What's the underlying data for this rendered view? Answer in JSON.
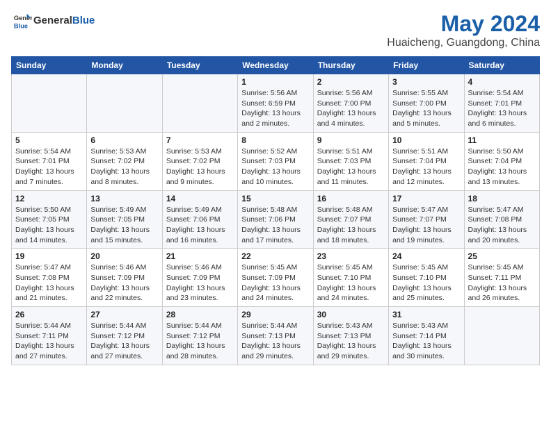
{
  "header": {
    "logo_general": "General",
    "logo_blue": "Blue",
    "title": "May 2024",
    "subtitle": "Huaicheng, Guangdong, China"
  },
  "days_of_week": [
    "Sunday",
    "Monday",
    "Tuesday",
    "Wednesday",
    "Thursday",
    "Friday",
    "Saturday"
  ],
  "weeks": [
    [
      {
        "day": "",
        "info": ""
      },
      {
        "day": "",
        "info": ""
      },
      {
        "day": "",
        "info": ""
      },
      {
        "day": "1",
        "info": "Sunrise: 5:56 AM\nSunset: 6:59 PM\nDaylight: 13 hours\nand 2 minutes."
      },
      {
        "day": "2",
        "info": "Sunrise: 5:56 AM\nSunset: 7:00 PM\nDaylight: 13 hours\nand 4 minutes."
      },
      {
        "day": "3",
        "info": "Sunrise: 5:55 AM\nSunset: 7:00 PM\nDaylight: 13 hours\nand 5 minutes."
      },
      {
        "day": "4",
        "info": "Sunrise: 5:54 AM\nSunset: 7:01 PM\nDaylight: 13 hours\nand 6 minutes."
      }
    ],
    [
      {
        "day": "5",
        "info": "Sunrise: 5:54 AM\nSunset: 7:01 PM\nDaylight: 13 hours\nand 7 minutes."
      },
      {
        "day": "6",
        "info": "Sunrise: 5:53 AM\nSunset: 7:02 PM\nDaylight: 13 hours\nand 8 minutes."
      },
      {
        "day": "7",
        "info": "Sunrise: 5:53 AM\nSunset: 7:02 PM\nDaylight: 13 hours\nand 9 minutes."
      },
      {
        "day": "8",
        "info": "Sunrise: 5:52 AM\nSunset: 7:03 PM\nDaylight: 13 hours\nand 10 minutes."
      },
      {
        "day": "9",
        "info": "Sunrise: 5:51 AM\nSunset: 7:03 PM\nDaylight: 13 hours\nand 11 minutes."
      },
      {
        "day": "10",
        "info": "Sunrise: 5:51 AM\nSunset: 7:04 PM\nDaylight: 13 hours\nand 12 minutes."
      },
      {
        "day": "11",
        "info": "Sunrise: 5:50 AM\nSunset: 7:04 PM\nDaylight: 13 hours\nand 13 minutes."
      }
    ],
    [
      {
        "day": "12",
        "info": "Sunrise: 5:50 AM\nSunset: 7:05 PM\nDaylight: 13 hours\nand 14 minutes."
      },
      {
        "day": "13",
        "info": "Sunrise: 5:49 AM\nSunset: 7:05 PM\nDaylight: 13 hours\nand 15 minutes."
      },
      {
        "day": "14",
        "info": "Sunrise: 5:49 AM\nSunset: 7:06 PM\nDaylight: 13 hours\nand 16 minutes."
      },
      {
        "day": "15",
        "info": "Sunrise: 5:48 AM\nSunset: 7:06 PM\nDaylight: 13 hours\nand 17 minutes."
      },
      {
        "day": "16",
        "info": "Sunrise: 5:48 AM\nSunset: 7:07 PM\nDaylight: 13 hours\nand 18 minutes."
      },
      {
        "day": "17",
        "info": "Sunrise: 5:47 AM\nSunset: 7:07 PM\nDaylight: 13 hours\nand 19 minutes."
      },
      {
        "day": "18",
        "info": "Sunrise: 5:47 AM\nSunset: 7:08 PM\nDaylight: 13 hours\nand 20 minutes."
      }
    ],
    [
      {
        "day": "19",
        "info": "Sunrise: 5:47 AM\nSunset: 7:08 PM\nDaylight: 13 hours\nand 21 minutes."
      },
      {
        "day": "20",
        "info": "Sunrise: 5:46 AM\nSunset: 7:09 PM\nDaylight: 13 hours\nand 22 minutes."
      },
      {
        "day": "21",
        "info": "Sunrise: 5:46 AM\nSunset: 7:09 PM\nDaylight: 13 hours\nand 23 minutes."
      },
      {
        "day": "22",
        "info": "Sunrise: 5:45 AM\nSunset: 7:09 PM\nDaylight: 13 hours\nand 24 minutes."
      },
      {
        "day": "23",
        "info": "Sunrise: 5:45 AM\nSunset: 7:10 PM\nDaylight: 13 hours\nand 24 minutes."
      },
      {
        "day": "24",
        "info": "Sunrise: 5:45 AM\nSunset: 7:10 PM\nDaylight: 13 hours\nand 25 minutes."
      },
      {
        "day": "25",
        "info": "Sunrise: 5:45 AM\nSunset: 7:11 PM\nDaylight: 13 hours\nand 26 minutes."
      }
    ],
    [
      {
        "day": "26",
        "info": "Sunrise: 5:44 AM\nSunset: 7:11 PM\nDaylight: 13 hours\nand 27 minutes."
      },
      {
        "day": "27",
        "info": "Sunrise: 5:44 AM\nSunset: 7:12 PM\nDaylight: 13 hours\nand 27 minutes."
      },
      {
        "day": "28",
        "info": "Sunrise: 5:44 AM\nSunset: 7:12 PM\nDaylight: 13 hours\nand 28 minutes."
      },
      {
        "day": "29",
        "info": "Sunrise: 5:44 AM\nSunset: 7:13 PM\nDaylight: 13 hours\nand 29 minutes."
      },
      {
        "day": "30",
        "info": "Sunrise: 5:43 AM\nSunset: 7:13 PM\nDaylight: 13 hours\nand 29 minutes."
      },
      {
        "day": "31",
        "info": "Sunrise: 5:43 AM\nSunset: 7:14 PM\nDaylight: 13 hours\nand 30 minutes."
      },
      {
        "day": "",
        "info": ""
      }
    ]
  ]
}
